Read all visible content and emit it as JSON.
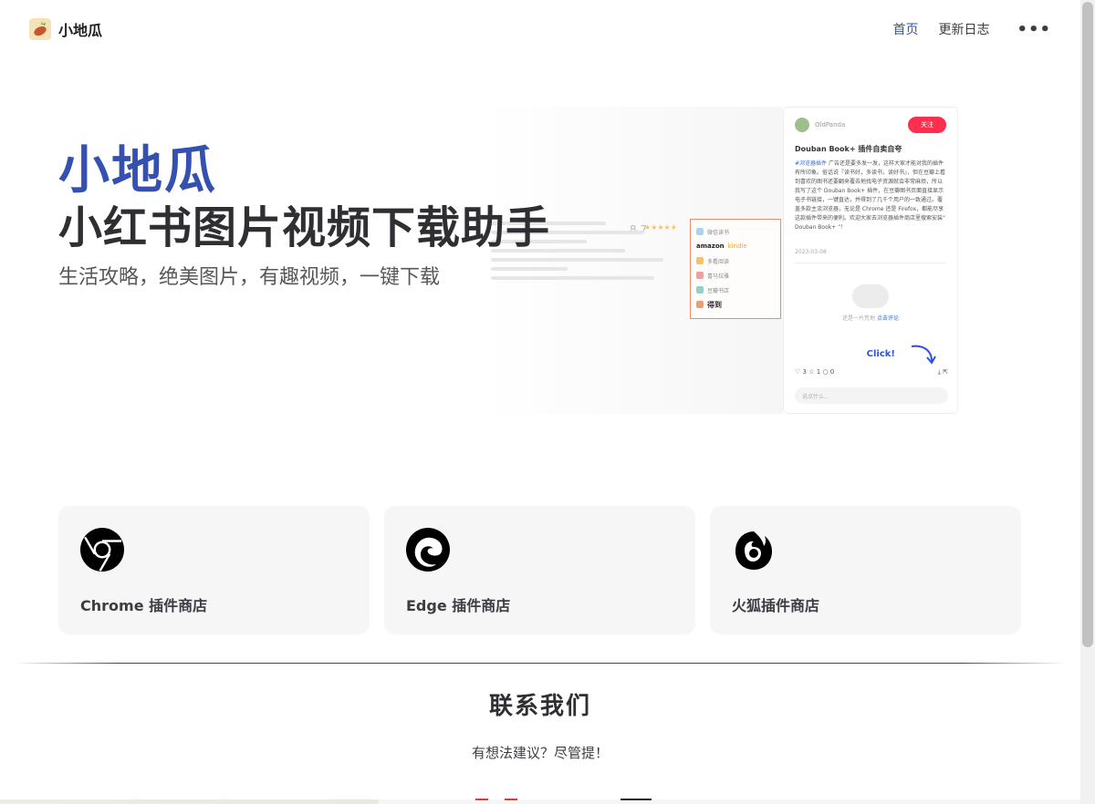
{
  "nav": {
    "brand_name": "小地瓜",
    "links": [
      {
        "label": "首页",
        "active": true
      },
      {
        "label": "更新日志",
        "active": false
      }
    ],
    "more": "•••"
  },
  "hero": {
    "title": "小地瓜",
    "subtitle": "小红书图片视频下载助手",
    "tagline": "生活攻略，绝美图片，有趣视频，一键下载",
    "preview": {
      "rating": "8.7",
      "box_items": [
        "微信读书",
        "amazon",
        "kindle",
        "多看阅读",
        "喜马拉雅",
        "豆瓣书店",
        "得到"
      ],
      "user": "OldPanda",
      "follow": "关注",
      "post_title": "Douban Book+ 插件自卖自夸",
      "post_tag": "#浏览器插件",
      "post_body": "广告还是要多发一发，这样大家才能对我的插件有所印象。俗话说『读书好，多读书，读好书』，但在豆瓣上看到喜欢的图书还要翻来覆去地找电子资源就会非常麻烦，所以我写了这个 Douban Book+ 插件，在豆瓣图书页面直接显示电子书链接，一键直达，并得到了几千个用户的一致通过。覆盖多款主流浏览器，无论是 Chrome 还是 Firefox，都能尽享这款插件带来的便利。欢迎大家去浏览器插件商店里搜索安装“ Douban Book+ ”！",
      "post_date": "2023-03-08",
      "empty_text": "还是一片荒地",
      "empty_link": "点击评论",
      "click_label": "Click!",
      "likes": "3",
      "stars": "1",
      "comments": "0",
      "comment_placeholder": "说点什么..."
    }
  },
  "cards": [
    {
      "label": "Chrome 插件商店",
      "icon": "chrome-icon"
    },
    {
      "label": "Edge 插件商店",
      "icon": "edge-icon"
    },
    {
      "label": "火狐插件商店",
      "icon": "firefox-icon"
    }
  ],
  "contact": {
    "title": "联系我们",
    "text": "有想法建议？尽管提！"
  },
  "colors": {
    "accent": "#3451b2",
    "card_bg": "#f6f6f7",
    "follow_red": "#ff2e4d"
  }
}
